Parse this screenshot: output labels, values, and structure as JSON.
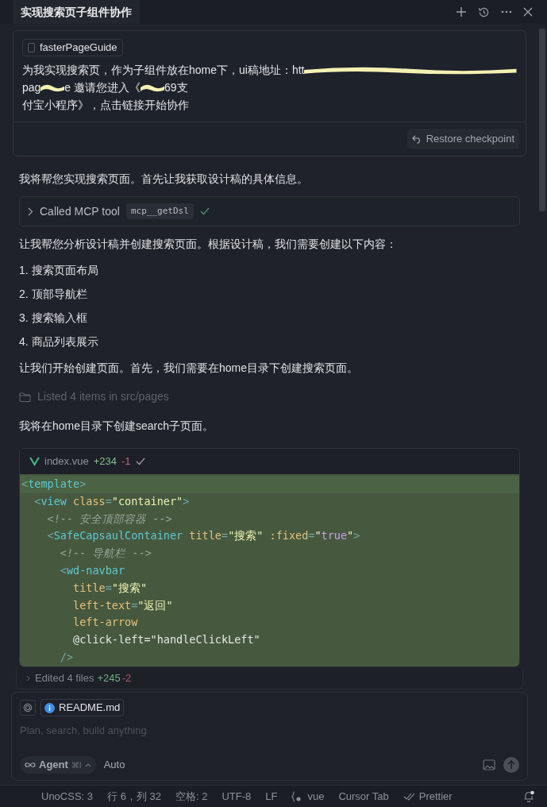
{
  "header": {
    "title": "实现搜索页子组件协作"
  },
  "user_message": {
    "context_chip": "fasterPageGuide",
    "lines": [
      [
        {
          "kind": "text",
          "text": "为我实现搜索页，作为子组件放在home下，ui稿地址：htt"
        },
        {
          "kind": "redacted"
        }
      ],
      [
        {
          "kind": "text",
          "text": "pag"
        },
        {
          "kind": "redacted"
        },
        {
          "kind": "text",
          "text": "e 邀请您进入《"
        },
        {
          "kind": "redacted"
        },
        {
          "kind": "text",
          "text": "69支"
        }
      ],
      [
        {
          "kind": "text",
          "text": "付宝小程序》，点击链接开始协作"
        }
      ]
    ],
    "restore_button": "Restore checkpoint"
  },
  "messages": [
    {
      "kind": "paragraph",
      "text": "我将帮您实现搜索页面。首先让我获取设计稿的具体信息。"
    },
    {
      "kind": "tool_call",
      "label": "Called MCP tool",
      "tool": "mcp__getDsl",
      "done": true
    },
    {
      "kind": "paragraph",
      "text": "让我帮您分析设计稿并创建搜索页面。根据设计稿，我们需要创建以下内容："
    },
    {
      "kind": "list_item",
      "number": "1.",
      "text": "搜索页面布局"
    },
    {
      "kind": "list_item",
      "number": "2.",
      "text": "顶部导航栏"
    },
    {
      "kind": "list_item",
      "number": "3.",
      "text": "搜索输入框"
    },
    {
      "kind": "list_item",
      "number": "4.",
      "text": "商品列表展示"
    },
    {
      "kind": "paragraph",
      "text": "让我们开始创建页面。首先，我们需要在home目录下创建搜索页面。"
    },
    {
      "kind": "listing",
      "text": "Listed 4 items in src/pages"
    },
    {
      "kind": "paragraph",
      "text": "我将在home目录下创建search子页面。"
    }
  ],
  "code_card": {
    "file": "index.vue",
    "added": "+234",
    "removed": "-1",
    "done": true,
    "lines": [
      [
        {
          "kind": "punct",
          "text": "<"
        },
        {
          "kind": "tag",
          "text": "template"
        },
        {
          "kind": "punct",
          "text": ">"
        }
      ],
      [
        {
          "kind": "punct",
          "text": "  <"
        },
        {
          "kind": "tag",
          "text": "view"
        },
        {
          "kind": "attr",
          "text": " class"
        },
        {
          "kind": "punct",
          "text": "="
        },
        {
          "kind": "string",
          "text": "\"container\""
        },
        {
          "kind": "punct",
          "text": ">"
        }
      ],
      [
        {
          "kind": "comment",
          "text": "    <!-- 安全顶部容器 -->"
        }
      ],
      [
        {
          "kind": "punct",
          "text": "    <"
        },
        {
          "kind": "tag",
          "text": "SafeCapsaulContainer"
        },
        {
          "kind": "attr",
          "text": " title"
        },
        {
          "kind": "punct",
          "text": "="
        },
        {
          "kind": "string",
          "text": "\"搜索\""
        },
        {
          "kind": "attr",
          "text": " :fixed"
        },
        {
          "kind": "punct",
          "text": "="
        },
        {
          "kind": "string",
          "text": "\""
        },
        {
          "kind": "keyword",
          "text": "true"
        },
        {
          "kind": "string",
          "text": "\""
        },
        {
          "kind": "punct",
          "text": ">"
        }
      ],
      [
        {
          "kind": "comment",
          "text": "      <!-- 导航栏 -->"
        }
      ],
      [
        {
          "kind": "punct",
          "text": "      <"
        },
        {
          "kind": "tag",
          "text": "wd-navbar"
        }
      ],
      [
        {
          "kind": "attr",
          "text": "        title"
        },
        {
          "kind": "punct",
          "text": "="
        },
        {
          "kind": "string",
          "text": "\"搜索\""
        }
      ],
      [
        {
          "kind": "attr",
          "text": "        left-text"
        },
        {
          "kind": "punct",
          "text": "="
        },
        {
          "kind": "string",
          "text": "\"返回\""
        }
      ],
      [
        {
          "kind": "attr",
          "text": "        left-arrow"
        }
      ],
      [
        {
          "kind": "plain",
          "text": "        @click-left=\"handleClickLeft\""
        }
      ],
      [
        {
          "kind": "punct",
          "text": "      />"
        }
      ]
    ]
  },
  "edited_summary": {
    "label": "Edited 4 files",
    "added": "+245",
    "removed": "-2"
  },
  "composer": {
    "attachment": "README.md",
    "placeholder": "Plan, search, build anything",
    "mode": "Agent",
    "shortcut": "⌘I",
    "model": "Auto"
  },
  "status_bar": [
    {
      "kind": "text",
      "text": "UnoCSS: 3"
    },
    {
      "kind": "text",
      "text": "行 6，列 32"
    },
    {
      "kind": "text",
      "text": "空格: 2"
    },
    {
      "kind": "text",
      "text": "UTF-8"
    },
    {
      "kind": "text",
      "text": "LF"
    },
    {
      "kind": "language",
      "text": "vue"
    },
    {
      "kind": "text",
      "text": "Cursor Tab"
    },
    {
      "kind": "prettier",
      "text": "Prettier"
    },
    {
      "kind": "bell"
    }
  ]
}
